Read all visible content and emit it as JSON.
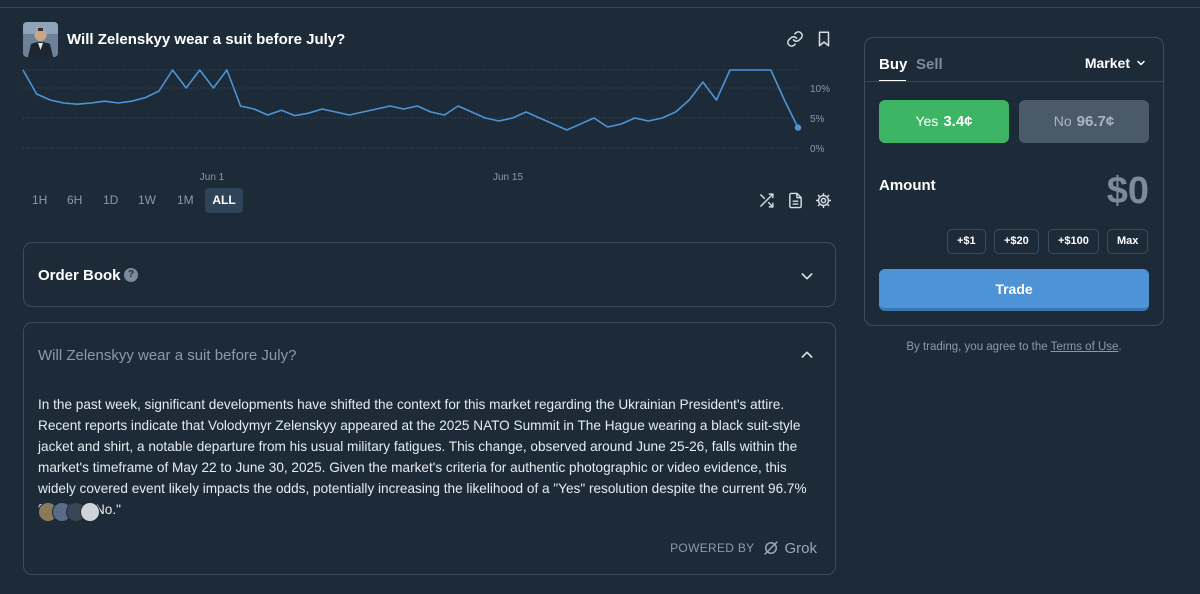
{
  "market": {
    "title": "Will Zelenskyy wear a suit before July?"
  },
  "chart_data": {
    "type": "line",
    "x_ticks": [
      "Jun 1",
      "Jun 15"
    ],
    "y_ticks": [
      "10%",
      "5%",
      "0%"
    ],
    "ylim": [
      0,
      13
    ],
    "grid": true,
    "series": [
      {
        "values": [
          13,
          9,
          8,
          7.5,
          7.3,
          7.5,
          7.8,
          7.5,
          7.8,
          8.4,
          9.5,
          13,
          10,
          13,
          10,
          13,
          7,
          6.5,
          5.5,
          6.3,
          5.4,
          5.8,
          6.5,
          6,
          5.5,
          6,
          6.5,
          7,
          6.5,
          7,
          6,
          5.5,
          7,
          6,
          5,
          4.5,
          5,
          6,
          5,
          4,
          3,
          4,
          5,
          3.5,
          4,
          5,
          4.5,
          5,
          6,
          8,
          11,
          8,
          13,
          13,
          13,
          13,
          8,
          3.4
        ],
        "color": "#4d93d5"
      }
    ]
  },
  "timeframes": {
    "items": [
      "1H",
      "6H",
      "1D",
      "1W",
      "1M",
      "ALL"
    ],
    "active": "ALL"
  },
  "order_book": {
    "title": "Order Book",
    "help": "?"
  },
  "ai_summary": {
    "title": "Will Zelenskyy wear a suit before July?",
    "text": "In the past week, significant developments have shifted the context for this market regarding the Ukrainian President's attire. Recent reports indicate that Volodymyr Zelenskyy appeared at the 2025 NATO Summit in The Hague wearing a black suit-style jacket and shirt, a notable departure from his usual military fatigues. This change, observed around June 25-26, falls within the market's timeframe of May 22 to June 30, 2025. Given the market's criteria for authentic photographic or video evidence, this widely covered event likely impacts the odds, potentially increasing the likelihood of a \"Yes\" resolution despite the current 96.7% favoring \"No.\"",
    "powered_by": "POWERED BY",
    "brand": "Grok"
  },
  "trade": {
    "tab_buy": "Buy",
    "tab_sell": "Sell",
    "order_type": "Market",
    "yes_label": "Yes",
    "yes_price": "3.4¢",
    "no_label": "No",
    "no_price": "96.7¢",
    "amount_label": "Amount",
    "amount_value": "$0",
    "quick_add": [
      "+$1",
      "+$20",
      "+$100",
      "Max"
    ],
    "trade_label": "Trade",
    "terms_prefix": "By trading, you agree to the",
    "terms_link": "Terms of Use",
    "terms_suffix": "."
  },
  "colors": {
    "background": "#1d2b39",
    "yes": "#3db565",
    "no": "#4b5a69",
    "accent": "#4d93d5"
  }
}
